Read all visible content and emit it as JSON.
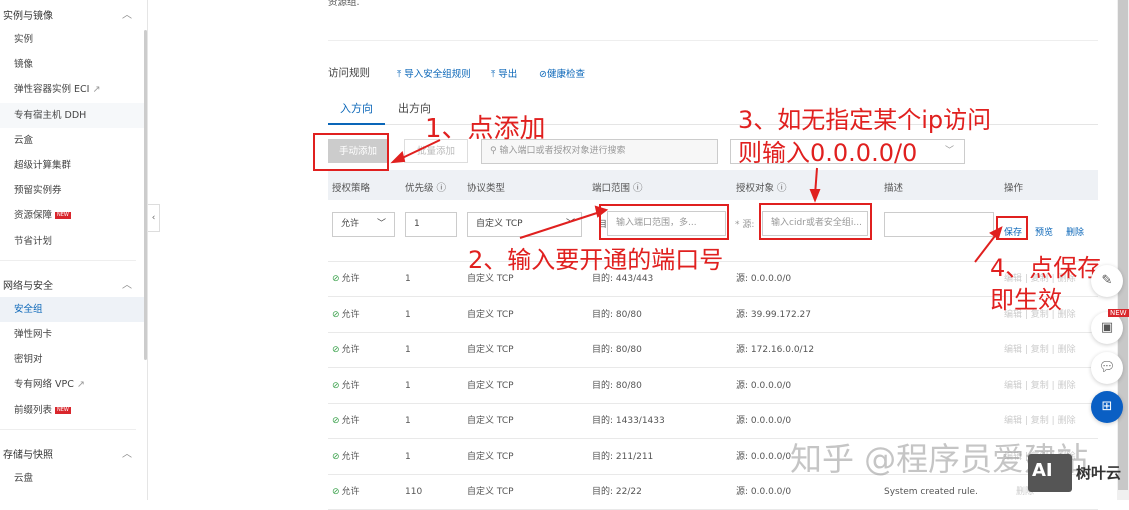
{
  "sidebar": {
    "groups": [
      {
        "title": "实例与镜像",
        "items": [
          {
            "label": "实例"
          },
          {
            "label": "镜像"
          },
          {
            "label": "弹性容器实例 ECI",
            "ext": "↗"
          },
          {
            "label": "专有宿主机 DDH"
          },
          {
            "label": "云盒"
          },
          {
            "label": "超级计算集群"
          },
          {
            "label": "预留实例券"
          },
          {
            "label": "资源保障",
            "badge": "NEW"
          },
          {
            "label": "节省计划"
          }
        ]
      },
      {
        "title": "网络与安全",
        "items": [
          {
            "label": "安全组"
          },
          {
            "label": "弹性网卡"
          },
          {
            "label": "密钥对"
          },
          {
            "label": "专有网络 VPC",
            "ext": "↗"
          },
          {
            "label": "前缀列表",
            "badge": "NEW"
          }
        ]
      },
      {
        "title": "存储与快照",
        "items": [
          {
            "label": "云盘"
          }
        ]
      }
    ]
  },
  "top_text": "资源组.",
  "toolbar": {
    "title": "访问规则",
    "import": "导入安全组规则",
    "export": "导出",
    "health": "健康检查"
  },
  "tabs": [
    {
      "label": "入方向"
    },
    {
      "label": "出方向"
    }
  ],
  "actions": {
    "manual_add": "手动添加",
    "batch_add": "批量添加",
    "search_placeholder": "输入端口或者授权对象进行搜索"
  },
  "columns": [
    "授权策略",
    "优先级",
    "协议类型",
    "端口范围",
    "授权对象",
    "描述",
    "操作"
  ],
  "edit_row": {
    "policy": "允许",
    "priority": "1",
    "protocol": "自定义 TCP",
    "dest_label": "目的",
    "port_placeholder": "输入端口范围，多...",
    "src_label": "* 源:",
    "src_placeholder": "输入cidr或者安全组i...",
    "save": "保存",
    "preview": "预览",
    "delete": "删除"
  },
  "rows": [
    {
      "policy": "允许",
      "priority": "1",
      "protocol": "自定义 TCP",
      "port": "目的: 443/443",
      "source": "源: 0.0.0.0/0",
      "desc": ""
    },
    {
      "policy": "允许",
      "priority": "1",
      "protocol": "自定义 TCP",
      "port": "目的: 80/80",
      "source": "源: 39.99.172.27",
      "desc": ""
    },
    {
      "policy": "允许",
      "priority": "1",
      "protocol": "自定义 TCP",
      "port": "目的: 80/80",
      "source": "源: 172.16.0.0/12",
      "desc": ""
    },
    {
      "policy": "允许",
      "priority": "1",
      "protocol": "自定义 TCP",
      "port": "目的: 80/80",
      "source": "源: 0.0.0.0/0",
      "desc": ""
    },
    {
      "policy": "允许",
      "priority": "1",
      "protocol": "自定义 TCP",
      "port": "目的: 1433/1433",
      "source": "源: 0.0.0.0/0",
      "desc": ""
    },
    {
      "policy": "允许",
      "priority": "1",
      "protocol": "自定义 TCP",
      "port": "目的: 211/211",
      "source": "源: 0.0.0.0/0",
      "desc": ""
    },
    {
      "policy": "允许",
      "priority": "110",
      "protocol": "自定义 TCP",
      "port": "目的: 22/22",
      "source": "源: 0.0.0.0/0",
      "desc": "System created rule."
    }
  ],
  "row_actions": {
    "edit": "编辑",
    "copy": "复制",
    "delete": "删除"
  },
  "annotations": {
    "a1": "1、点添加",
    "a2": "2、输入要开通的端口号",
    "a3a": "3、如无指定某个ip访问",
    "a3b": "则输入0.0.0.0/0",
    "a4a": "4、点保存",
    "a4b": "即生效"
  },
  "fab": {
    "new_badge": "NEW"
  },
  "watermark": "知乎 @程序员爱建站",
  "logo": {
    "mark": "AI",
    "name": "树叶云"
  },
  "colors": {
    "accent": "#0a66b8",
    "annotation": "#e0201f",
    "header_bg": "#eef1f5"
  }
}
